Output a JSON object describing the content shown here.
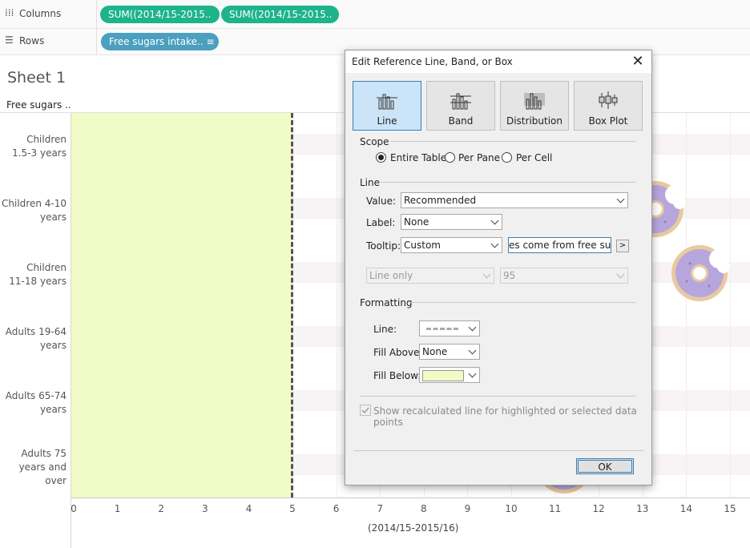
{
  "shelves": {
    "columns_label": "Columns",
    "rows_label": "Rows",
    "columns_pills": [
      "SUM((2014/15-2015..",
      "SUM((2014/15-2015.."
    ],
    "rows_pill": "Free sugars intake.. ≡",
    "columns_icon": "columns-icon",
    "rows_icon": "rows-icon"
  },
  "sheet": {
    "title": "Sheet 1",
    "row_header_title": "Free sugars .."
  },
  "chart_data": {
    "type": "bar",
    "categories": [
      "Children 1.5-3 years",
      "Children 4-10 years",
      "Children 11-18 years",
      "Adults 19-64 years",
      "Adults 65-74 years",
      "Adults 75 years and over"
    ],
    "category_lines": [
      [
        "Children",
        "1.5-3 years"
      ],
      [
        "Children 4-10",
        "years"
      ],
      [
        "Children",
        "11-18 years"
      ],
      [
        "Adults 19-64",
        "years"
      ],
      [
        "Adults 65-74",
        "years"
      ],
      [
        "Adults 75",
        "years and",
        "over"
      ]
    ],
    "x_ticks": [
      "0",
      "1",
      "2",
      "3",
      "4",
      "5",
      "6",
      "7",
      "8",
      "9",
      "10",
      "11",
      "12",
      "13",
      "14",
      "15"
    ],
    "xlabel": "(2014/15-2015/16)",
    "xlim": [
      0,
      15.5
    ],
    "reference_line": {
      "value": 5,
      "style": "dashed",
      "fill_below": "#f1fbc6"
    },
    "marks": "donut-image",
    "donuts": [
      {
        "row": "Children 4-10 years",
        "x": 13.3
      },
      {
        "row": "Children 11-18 years",
        "x": 14.3
      },
      {
        "row": "Adults 75 years and over",
        "x": 11.2
      }
    ]
  },
  "dialog": {
    "title": "Edit Reference Line, Band, or Box",
    "types": [
      {
        "label": "Line",
        "icon": "line-type-icon",
        "selected": true
      },
      {
        "label": "Band",
        "icon": "band-type-icon",
        "selected": false
      },
      {
        "label": "Distribution",
        "icon": "distribution-type-icon",
        "selected": false
      },
      {
        "label": "Box Plot",
        "icon": "box-plot-type-icon",
        "selected": false
      }
    ],
    "scope": {
      "label": "Scope",
      "options": [
        {
          "label": "Entire Table",
          "checked": true
        },
        {
          "label": "Per Pane",
          "checked": false
        },
        {
          "label": "Per Cell",
          "checked": false
        }
      ]
    },
    "line": {
      "label": "Line",
      "value_label": "Value:",
      "value": "Recommended",
      "label_label": "Label:",
      "label_value": "None",
      "tooltip_label": "Tooltip:",
      "tooltip_value": "Custom",
      "tooltip_text": "es come from free sugars!|",
      "tooltip_arrow": ">",
      "line_only": "Line only",
      "percent": "95"
    },
    "formatting": {
      "label": "Formatting",
      "line_label": "Line:",
      "fill_above_label": "Fill Above:",
      "fill_above": "None",
      "fill_below_label": "Fill Below:",
      "fill_below_color": "#f1fbc6"
    },
    "recalc_label": "Show recalculated line for highlighted or selected data points",
    "ok_label": "OK"
  }
}
